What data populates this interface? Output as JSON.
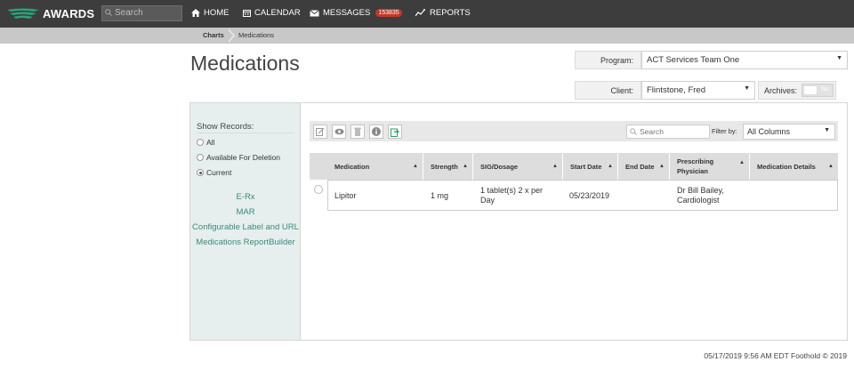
{
  "brand": {
    "name": "AWARDS"
  },
  "top_search": {
    "placeholder": "Search"
  },
  "nav": [
    {
      "label": "HOME",
      "icon": "home-icon"
    },
    {
      "label": "CALENDAR",
      "icon": "calendar-icon"
    },
    {
      "label": "MESSAGES",
      "icon": "envelope-icon",
      "badge": "153835"
    },
    {
      "label": "REPORTS",
      "icon": "chart-line-icon"
    }
  ],
  "breadcrumb": {
    "items": [
      "Charts",
      "Medications"
    ]
  },
  "page_title": "Medications",
  "program": {
    "label": "Program:",
    "value": "ACT Services Team One"
  },
  "client": {
    "label": "Client:",
    "value": "Flintstone, Fred"
  },
  "archives": {
    "label": "Archives:",
    "toggle": "No"
  },
  "sidebar": {
    "show_records_label": "Show Records:",
    "options": [
      {
        "label": "All",
        "selected": false
      },
      {
        "label": "Available For Deletion",
        "selected": false
      },
      {
        "label": "Current",
        "selected": true
      }
    ],
    "links": [
      "E-Rx",
      "MAR",
      "Configurable Label and URL",
      "Medications ReportBuilder"
    ]
  },
  "toolbar": {
    "icons": [
      "edit-icon",
      "view-icon",
      "delete-icon",
      "info-icon",
      "export-icon"
    ],
    "search_placeholder": "Search",
    "filter_label": "Filter by:",
    "filter_value": "All Columns"
  },
  "table": {
    "columns": [
      "Medication",
      "Strength",
      "SIG/Dosage",
      "Start Date",
      "End Date",
      "Prescribing Physician",
      "Medication Details"
    ],
    "rows": [
      [
        "Lipitor",
        "1 mg",
        "1 tablet(s) 2 x per Day",
        "05/23/2019",
        "",
        "Dr Bill Bailey, Cardiologist",
        ""
      ]
    ]
  },
  "footer": {
    "text": "05/17/2019 9:56 AM EDT  Foothold © 2019"
  },
  "colors": {
    "topbar": "#3d3d3d",
    "link": "#3b8a7a",
    "badge": "#c0392b",
    "sidebar": "#e6efee"
  }
}
